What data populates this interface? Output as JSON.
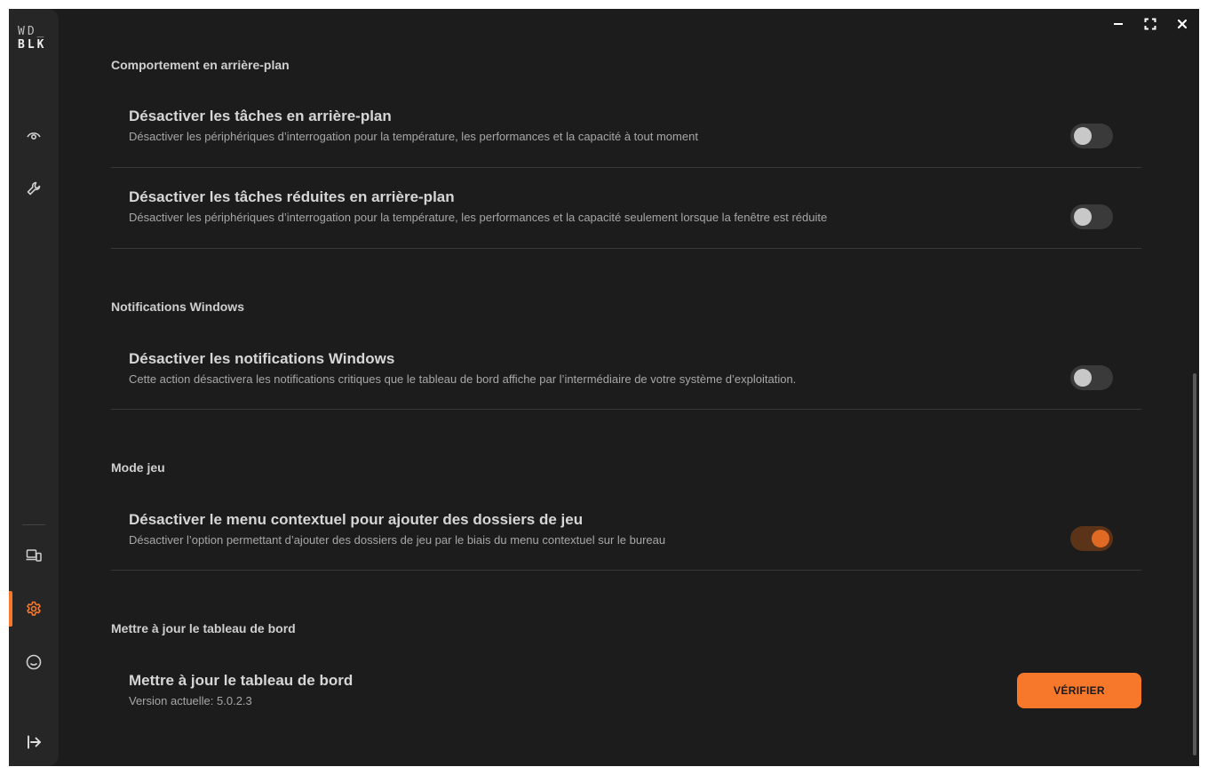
{
  "app": {
    "logo_line1": "WD_",
    "logo_line2": "BLK"
  },
  "sidebar": {
    "items": [
      {
        "icon": "eye-icon",
        "active": false
      },
      {
        "icon": "wrench-icon",
        "active": false
      },
      {
        "icon": "devices-icon",
        "active": false
      },
      {
        "icon": "gear-icon",
        "active": true
      },
      {
        "icon": "smiley-icon",
        "active": false
      },
      {
        "icon": "logout-icon",
        "active": false
      }
    ],
    "accent_color": "#f7782a"
  },
  "window_controls": [
    "minimize-icon",
    "maximize-icon",
    "close-icon"
  ],
  "sections": {
    "background": {
      "title": "Comportement en arrière-plan",
      "settings": [
        {
          "title": "Désactiver les tâches en arrière-plan",
          "desc": "Désactiver les périphériques d’interrogation pour la température, les performances et la capacité à tout moment",
          "enabled": false
        },
        {
          "title": "Désactiver les tâches réduites en arrière-plan",
          "desc": "Désactiver les périphériques d’interrogation pour la température, les performances et la capacité seulement lorsque la fenêtre est réduite",
          "enabled": false
        }
      ]
    },
    "notifications": {
      "title": "Notifications Windows",
      "settings": [
        {
          "title": "Désactiver les notifications Windows",
          "desc": "Cette action désactivera les notifications critiques que le tableau de bord affiche par l’intermédiaire de votre système d’exploitation.",
          "enabled": false
        }
      ]
    },
    "game_mode": {
      "title": "Mode jeu",
      "settings": [
        {
          "title": "Désactiver le menu contextuel pour ajouter des dossiers de jeu",
          "desc": "Désactiver l’option permettant d’ajouter des dossiers de jeu par le biais du menu contextuel sur le bureau",
          "enabled": true
        }
      ]
    },
    "update": {
      "title": "Mettre à jour le tableau de bord",
      "setting_title": "Mettre à jour le tableau de bord",
      "version": "Version actuelle: 5.0.2.3",
      "button_label": "VÉRIFIER"
    }
  }
}
